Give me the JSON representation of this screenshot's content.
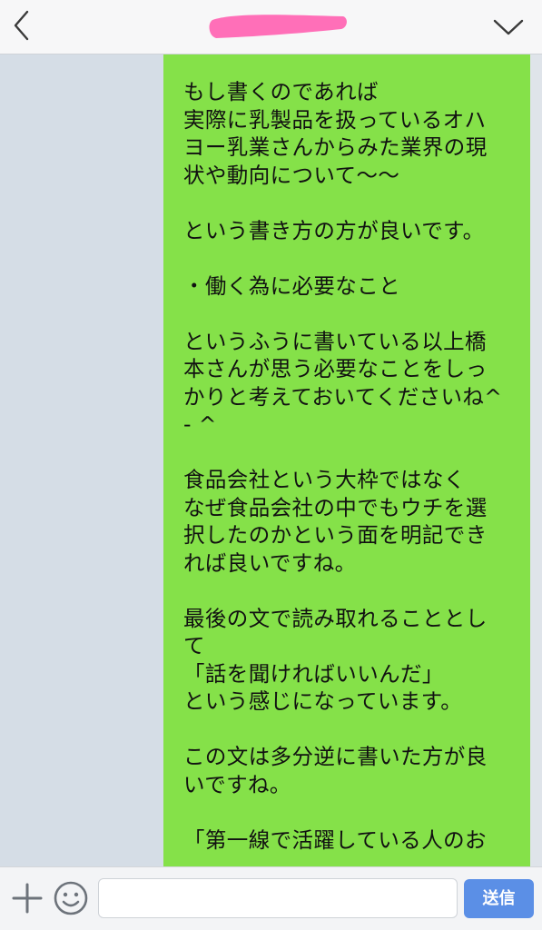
{
  "header": {
    "back_icon": "chevron-left-icon",
    "menu_icon": "chevron-down-icon",
    "title_redaction_color": "#ff6fb8"
  },
  "chat": {
    "bubble_color": "#85e149",
    "message_lines": [
      "もし書くのであれば",
      "実際に乳製品を扱っているオハ",
      "ヨー乳業さんからみた業界の現",
      "状や動向について〜〜",
      "",
      "という書き方の方が良いです。",
      "",
      "・働く為に必要なこと",
      "",
      "というふうに書いている以上橋",
      "本さんが思う必要なことをしっ",
      "かりと考えておいてくださいね^",
      "- ^",
      "",
      "食品会社という大枠ではなく",
      "なぜ食品会社の中でもウチを選",
      "択したのかという面を明記でき",
      "れば良いですね。",
      "",
      "最後の文で読み取れることとし",
      "て",
      "「話を聞ければいいんだ」",
      "という感じになっています。",
      "",
      "この文は多分逆に書いた方が良",
      "いですね。",
      "",
      "「第一線で活躍している人のお"
    ]
  },
  "footer": {
    "plus_icon": "plus-icon",
    "emoji_icon": "smiley-icon",
    "input_value": "",
    "send_label": "送信",
    "send_color": "#5b8fe6"
  }
}
